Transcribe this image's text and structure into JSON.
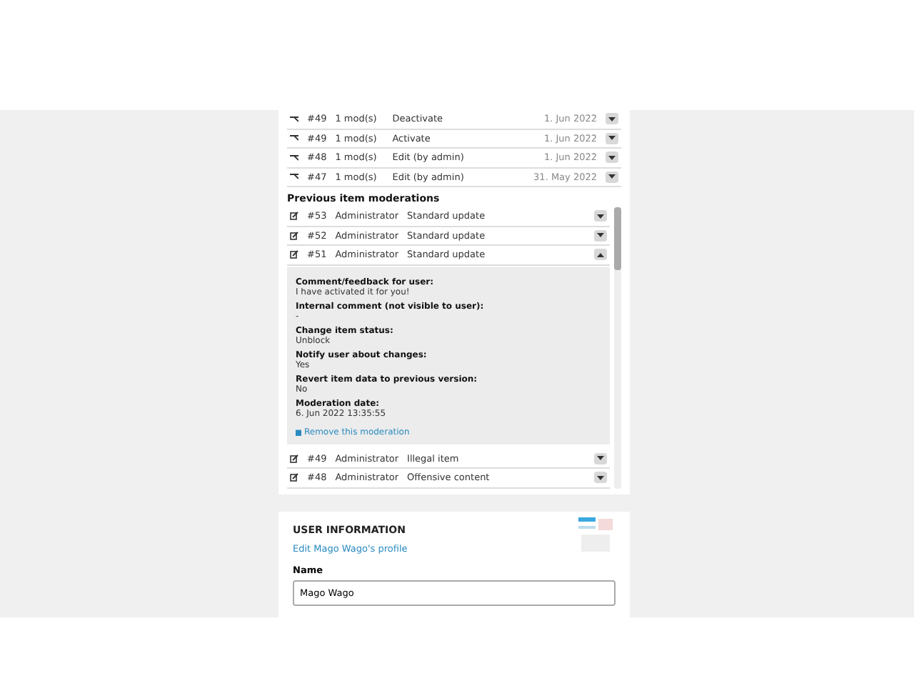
{
  "item_edits": [
    {
      "id": "#49",
      "mods": "1 mod(s)",
      "action": "Deactivate",
      "date": "1. Jun 2022"
    },
    {
      "id": "#49",
      "mods": "1 mod(s)",
      "action": "Activate",
      "date": "1. Jun 2022"
    },
    {
      "id": "#48",
      "mods": "1 mod(s)",
      "action": "Edit (by admin)",
      "date": "1. Jun 2022"
    },
    {
      "id": "#47",
      "mods": "1 mod(s)",
      "action": "Edit (by admin)",
      "date": "31. May 2022"
    }
  ],
  "moderations": {
    "title": "Previous item moderations",
    "rows": [
      {
        "id": "#53",
        "author": "Administrator",
        "type": "Standard update",
        "expanded": false
      },
      {
        "id": "#52",
        "author": "Administrator",
        "type": "Standard update",
        "expanded": false
      },
      {
        "id": "#51",
        "author": "Administrator",
        "type": "Standard update",
        "expanded": true,
        "details": [
          {
            "label": "Comment/feedback for user:",
            "value": "I have activated it for you!"
          },
          {
            "label": "Internal comment (not visible to user):",
            "value": "-"
          },
          {
            "label": "Change item status:",
            "value": "Unblock"
          },
          {
            "label": "Notify user about changes:",
            "value": "Yes"
          },
          {
            "label": "Revert item data to previous version:",
            "value": "No"
          },
          {
            "label": "Moderation date:",
            "value": "6. Jun 2022 13:35:55"
          }
        ],
        "remove_link": "Remove this moderation"
      },
      {
        "id": "#49",
        "author": "Administrator",
        "type": "Illegal item",
        "expanded": false
      },
      {
        "id": "#48",
        "author": "Administrator",
        "type": "Offensive content",
        "expanded": false
      }
    ]
  },
  "user_info": {
    "title": "USER INFORMATION",
    "edit_link": "Edit Mago Wago's profile",
    "name_label": "Name",
    "name_value": "Mago Wago"
  }
}
